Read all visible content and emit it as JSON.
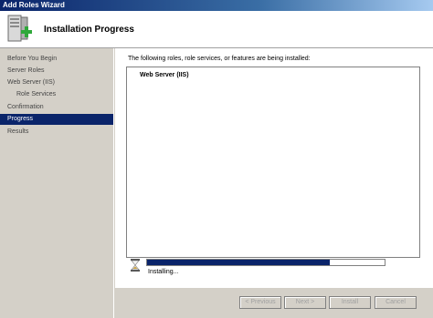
{
  "window": {
    "title": "Add Roles Wizard"
  },
  "header": {
    "title": "Installation Progress",
    "icon": "server-roles-icon"
  },
  "sidebar": {
    "items": [
      {
        "label": "Before You Begin",
        "active": false,
        "sub": false
      },
      {
        "label": "Server Roles",
        "active": false,
        "sub": false
      },
      {
        "label": "Web Server (IIS)",
        "active": false,
        "sub": false
      },
      {
        "label": "Role Services",
        "active": false,
        "sub": true
      },
      {
        "label": "Confirmation",
        "active": false,
        "sub": false
      },
      {
        "label": "Progress",
        "active": true,
        "sub": false
      },
      {
        "label": "Results",
        "active": false,
        "sub": false
      }
    ]
  },
  "main": {
    "description": "The following roles, role services, or features are being installed:",
    "items": [
      {
        "label": "Web Server (IIS)"
      }
    ],
    "progress": {
      "fraction": 0.77,
      "status": "Installing..."
    }
  },
  "buttons": {
    "previous": "< Previous",
    "next": "Next >",
    "install": "Install",
    "cancel": "Cancel"
  },
  "colors": {
    "selection": "#0a246a",
    "progress": "#0a246a",
    "titlebar": "#0a246a"
  }
}
